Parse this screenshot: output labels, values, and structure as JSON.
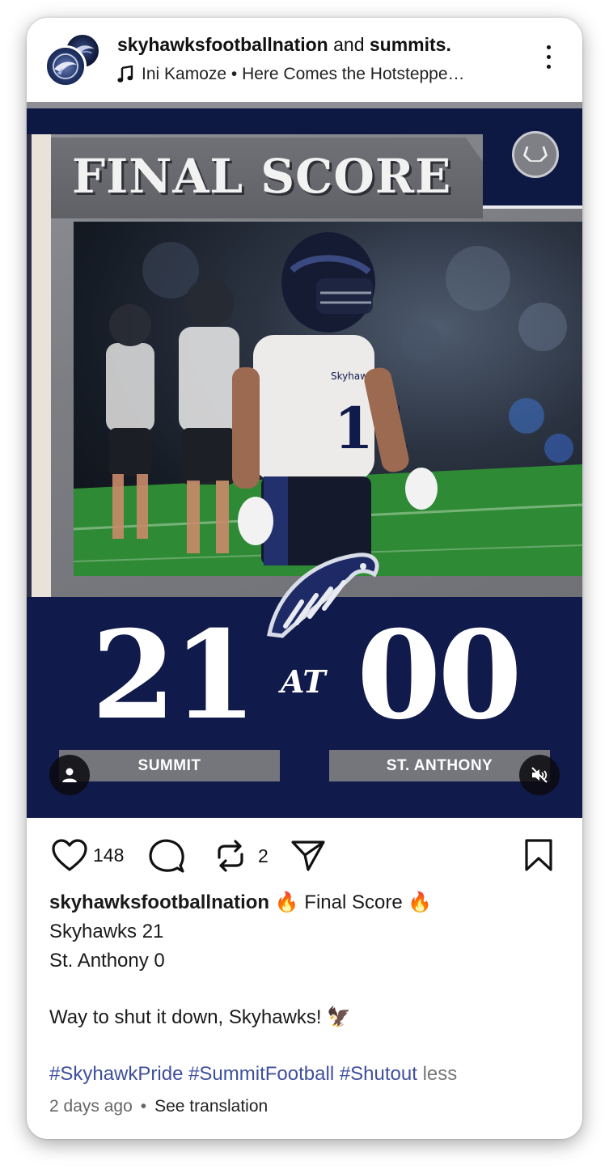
{
  "header": {
    "account_primary": "skyhawksfootballnation",
    "joiner": "and",
    "account_secondary": "summits.",
    "audio": "Ini Kamoze • Here Comes the Hotsteppe…"
  },
  "media": {
    "title": "FINAL SCORE",
    "score_left": "21",
    "score_at": "AT",
    "score_right": "00",
    "team_left": "SUMMIT",
    "team_right": "ST. ANTHONY",
    "jersey_text": "Skyhawks",
    "jersey_number": "11",
    "colors": {
      "navy": "#101a4b",
      "stone": "#7c7e83",
      "plate": "#74767c"
    }
  },
  "actions": {
    "likes": "148",
    "reposts": "2",
    "icons": [
      "heart-icon",
      "comment-icon",
      "repost-icon",
      "share-icon",
      "bookmark-icon"
    ]
  },
  "caption": {
    "user": "skyhawksfootballnation",
    "headline": "Final Score",
    "line1": "Skyhawks 21",
    "line2": "St. Anthony 0",
    "line3": "Way to shut it down, Skyhawks!",
    "hashtags": "#SkyhawkPride #SummitFootball #Shutout",
    "less": "less",
    "fire_emoji": "🔥",
    "eagle_emoji": "🦅"
  },
  "meta": {
    "time": "2 days ago",
    "dot": "•",
    "translate": "See translation"
  }
}
